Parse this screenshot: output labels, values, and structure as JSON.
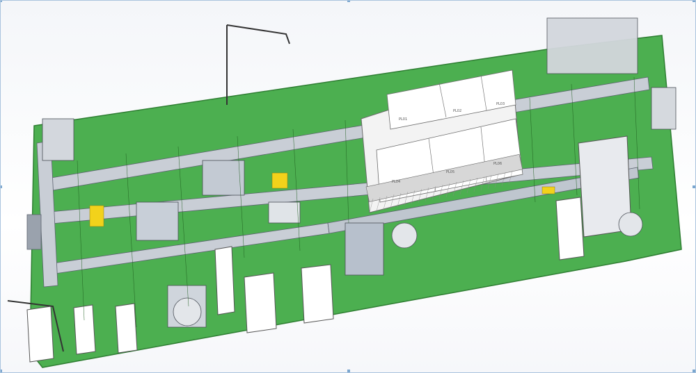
{
  "colors": {
    "floor": "#4caf50",
    "floor_edge": "#2e7d32",
    "frame": "#c9ced6",
    "frame_edge": "#5d6470",
    "cabinet": "#ffffff",
    "oven": "#f0f0f0",
    "machine": "#bfc6cf",
    "accent_yellow": "#f2d21b",
    "accent_green": "#2e8b2e",
    "selection_handle": "#7aa6cf",
    "border": "#a9c3de"
  },
  "scene": {
    "description_free": true,
    "oven_labels": [
      "PL01",
      "PL02",
      "PL03",
      "PL04",
      "PL05",
      "PL06"
    ]
  }
}
